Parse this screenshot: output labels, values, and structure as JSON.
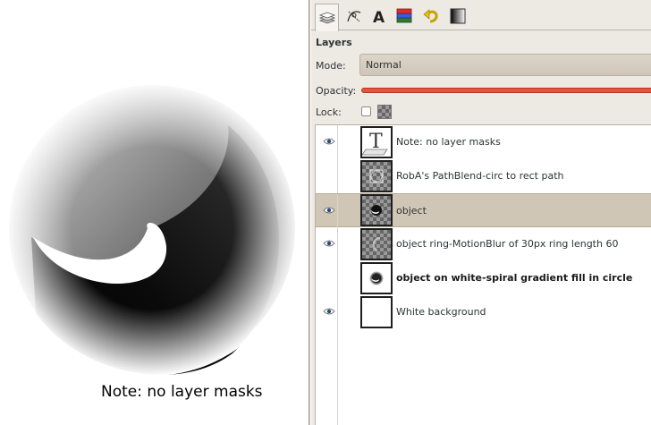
{
  "canvas": {
    "caption": "Note: no layer masks"
  },
  "dock": {
    "tabs": [
      {
        "icon": "layers-icon",
        "active": true
      },
      {
        "icon": "paths-icon",
        "active": false
      },
      {
        "icon": "text-tool-icon",
        "active": false
      },
      {
        "icon": "channels-icon",
        "active": false
      },
      {
        "icon": "undo-history-icon",
        "active": false
      },
      {
        "icon": "gradients-icon",
        "active": false
      }
    ],
    "title": "Layers",
    "mode_label": "Mode:",
    "mode_value": "Normal",
    "opacity_label": "Opacity:",
    "opacity_value": 1.0,
    "lock_label": "Lock:"
  },
  "layers": [
    {
      "name": "Note: no layer masks",
      "visible": true,
      "thumb": "text-layer",
      "selected": false,
      "bold": false
    },
    {
      "name": "RobA's PathBlend-circ to rect path",
      "visible": false,
      "thumb": "path-blend",
      "selected": false,
      "bold": false
    },
    {
      "name": "object",
      "visible": true,
      "thumb": "object",
      "selected": true,
      "bold": false
    },
    {
      "name": "object ring-MotionBlur of 30px ring length 60",
      "visible": true,
      "thumb": "ring",
      "selected": false,
      "bold": false
    },
    {
      "name": "object on white-spiral gradient fill in circle",
      "visible": false,
      "thumb": "spiral-white",
      "selected": false,
      "bold": true
    },
    {
      "name": "White background",
      "visible": true,
      "thumb": "white",
      "selected": false,
      "bold": false
    }
  ],
  "colors": {
    "dock_bg": "#ede9e3",
    "selected_row": "#d0c6b6",
    "opacity_bar": "#e4553d"
  }
}
